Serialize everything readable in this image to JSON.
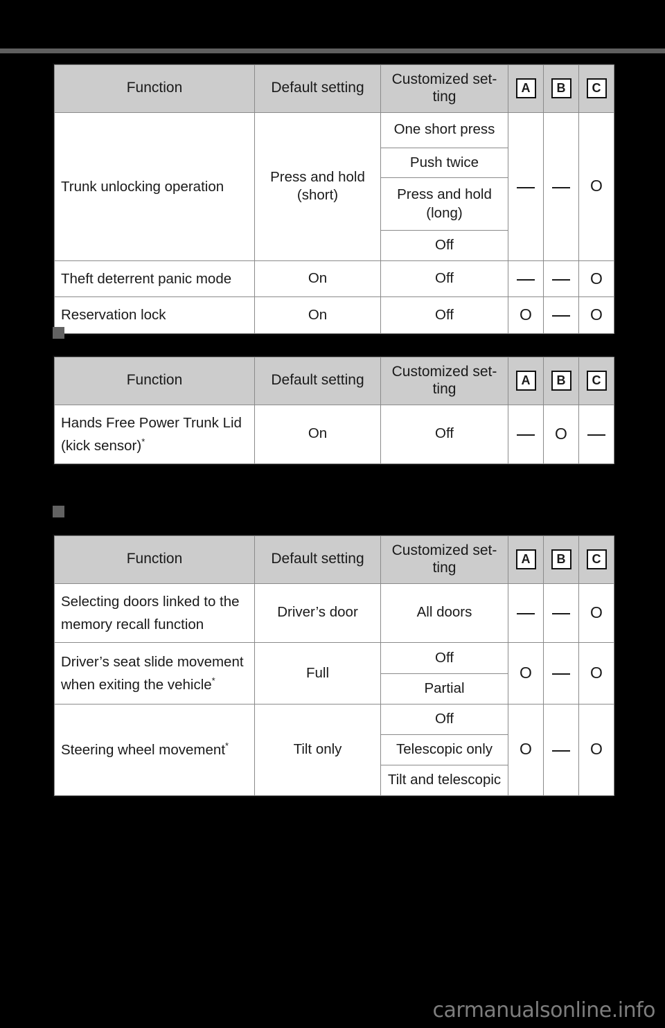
{
  "page": {
    "background_color": "#000000",
    "rule_color": "#5f5f5f",
    "header_fill": "#cccccc",
    "marker_color": "#626262",
    "watermark": "carmanualsonline.info"
  },
  "glyphs": {
    "circle": "O",
    "dash": "—",
    "asterisk": "*"
  },
  "columns": {
    "function": "Function",
    "default_setting": "Default setting",
    "customized_setting": "Customized set-\nting",
    "a": "A",
    "b": "B",
    "c": "C"
  },
  "tables": [
    {
      "name": "table-trunk-and-lock",
      "section_title": "",
      "headers": [
        "Function",
        "Default setting",
        "Customized set-ting",
        "A",
        "B",
        "C"
      ],
      "rows": [
        {
          "function": "Trunk unlocking operation",
          "default": "Press and hold\n(short)",
          "customized": [
            "One short press",
            "Push twice",
            "Press and hold\n(long)",
            "Off"
          ],
          "a": "—",
          "b": "—",
          "c": "O"
        },
        {
          "function": "Theft deterrent panic mode",
          "default": "On",
          "customized": [
            "Off"
          ],
          "a": "—",
          "b": "—",
          "c": "O"
        },
        {
          "function": "Reservation lock",
          "default": "On",
          "customized": [
            "Off"
          ],
          "a": "O",
          "b": "—",
          "c": "O"
        }
      ]
    },
    {
      "name": "table-hands-free-trunk",
      "section_title": "",
      "headers": [
        "Function",
        "Default setting",
        "Customized set-ting",
        "A",
        "B",
        "C"
      ],
      "rows": [
        {
          "function": "Hands Free Power Trunk Lid\n(kick sensor)",
          "function_asterisk": true,
          "default": "On",
          "customized": [
            "Off"
          ],
          "a": "—",
          "b": "O",
          "c": "—"
        }
      ]
    },
    {
      "name": "table-memory-and-steering",
      "section_title": "",
      "headers": [
        "Function",
        "Default setting",
        "Customized set-ting",
        "A",
        "B",
        "C"
      ],
      "rows": [
        {
          "function": "Selecting doors linked to the\nmemory recall function",
          "function_asterisk": false,
          "default": "Driver’s door",
          "customized": [
            "All doors"
          ],
          "a": "—",
          "b": "—",
          "c": "O"
        },
        {
          "function": "Driver’s seat slide movement\nwhen exiting the vehicle",
          "function_asterisk": true,
          "default": "Full",
          "customized": [
            "Off",
            "Partial"
          ],
          "a": "O",
          "b": "—",
          "c": "O"
        },
        {
          "function": "Steering wheel movement",
          "function_asterisk": true,
          "default": "Tilt only",
          "customized": [
            "Off",
            "Telescopic only",
            "Tilt and telescopic"
          ],
          "a": "O",
          "b": "—",
          "c": "O"
        }
      ]
    }
  ],
  "cells": {
    "t1r1_func": "Trunk unlocking operation",
    "t1r1_def_l1": "Press and hold",
    "t1r1_def_l2": "(short)",
    "t1r1_c1": "One short press",
    "t1r1_c2": "Push twice",
    "t1r1_c3_l1": "Press and hold",
    "t1r1_c3_l2": "(long)",
    "t1r1_c4": "Off",
    "t1r2_func": "Theft deterrent panic mode",
    "t1r2_def": "On",
    "t1r2_cust": "Off",
    "t1r3_func": "Reservation lock",
    "t1r3_def": "On",
    "t1r3_cust": "Off",
    "t2r1_func_l1": "Hands Free Power Trunk Lid",
    "t2r1_func_l2": "(kick sensor)",
    "t2r1_def": "On",
    "t2r1_cust": "Off",
    "t3r1_func_l1": "Selecting doors linked to the",
    "t3r1_func_l2": "memory recall function",
    "t3r1_def": "Driver’s door",
    "t3r1_cust": "All doors",
    "t3r2_func_l1": "Driver’s seat slide movement",
    "t3r2_func_l2": "when exiting the vehicle",
    "t3r2_def": "Full",
    "t3r2_c1": "Off",
    "t3r2_c2": "Partial",
    "t3r3_func": "Steering wheel movement",
    "t3r3_def": "Tilt only",
    "t3r3_c1": "Off",
    "t3r3_c2": "Telescopic only",
    "t3r3_c3": "Tilt and telescopic"
  }
}
